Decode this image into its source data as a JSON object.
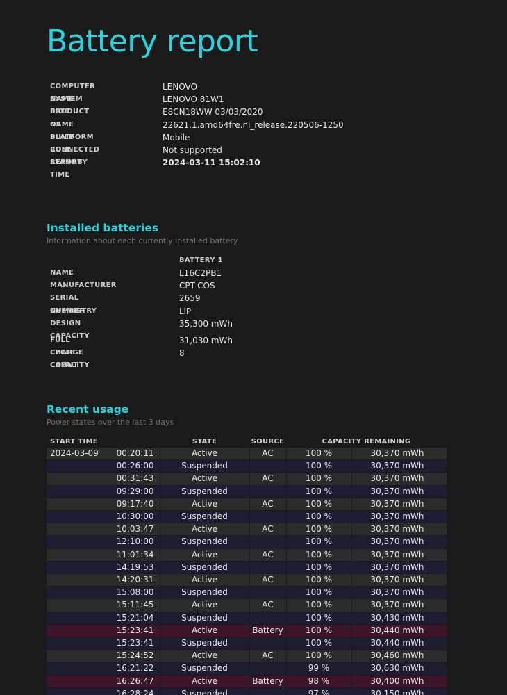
{
  "title": "Battery report",
  "system": [
    {
      "label": "COMPUTER NAME",
      "value": "LENOVO"
    },
    {
      "label": "SYSTEM PRODUCT NAME",
      "value": "LENOVO 81W1"
    },
    {
      "label": "BIOS",
      "value": "E8CN18WW 03/03/2020"
    },
    {
      "label": "OS BUILD",
      "value": "22621.1.amd64fre.ni_release.220506-1250"
    },
    {
      "label": "PLATFORM ROLE",
      "value": "Mobile"
    },
    {
      "label": "CONNECTED STANDBY",
      "value": "Not supported"
    },
    {
      "label": "REPORT TIME",
      "value": "2024-03-11  15:02:10"
    }
  ],
  "installed": {
    "heading": "Installed batteries",
    "subheading": "Information about each currently installed battery",
    "battery_header": "BATTERY 1",
    "rows": [
      {
        "label": "NAME",
        "value": "L16C2PB1"
      },
      {
        "label": "MANUFACTURER",
        "value": "CPT-COS"
      },
      {
        "label": "SERIAL NUMBER",
        "value": "2659"
      },
      {
        "label": "CHEMISTRY",
        "value": "LiP"
      },
      {
        "label": "DESIGN CAPACITY",
        "value": "35,300 mWh"
      },
      {
        "label": "FULL CHARGE CAPACITY",
        "value": "31,030 mWh"
      },
      {
        "label": "CYCLE COUNT",
        "value": "8"
      }
    ]
  },
  "recent": {
    "heading": "Recent usage",
    "subheading": "Power states over the last 3 days",
    "columns": {
      "start_time": "START TIME",
      "state": "STATE",
      "source": "SOURCE",
      "capacity": "CAPACITY REMAINING"
    },
    "rows": [
      {
        "date": "2024-03-09",
        "time": "00:20:11",
        "state": "Active",
        "source": "AC",
        "pct": "100 %",
        "cap": "30,370 mWh",
        "kind": "active"
      },
      {
        "date": "",
        "time": "00:26:00",
        "state": "Suspended",
        "source": "",
        "pct": "100 %",
        "cap": "30,370 mWh",
        "kind": "susp"
      },
      {
        "date": "",
        "time": "00:31:43",
        "state": "Active",
        "source": "AC",
        "pct": "100 %",
        "cap": "30,370 mWh",
        "kind": "active"
      },
      {
        "date": "",
        "time": "09:29:00",
        "state": "Suspended",
        "source": "",
        "pct": "100 %",
        "cap": "30,370 mWh",
        "kind": "susp"
      },
      {
        "date": "",
        "time": "09:17:40",
        "state": "Active",
        "source": "AC",
        "pct": "100 %",
        "cap": "30,370 mWh",
        "kind": "active"
      },
      {
        "date": "",
        "time": "10:30:00",
        "state": "Suspended",
        "source": "",
        "pct": "100 %",
        "cap": "30,370 mWh",
        "kind": "susp"
      },
      {
        "date": "",
        "time": "10:03:47",
        "state": "Active",
        "source": "AC",
        "pct": "100 %",
        "cap": "30,370 mWh",
        "kind": "active"
      },
      {
        "date": "",
        "time": "12:10:00",
        "state": "Suspended",
        "source": "",
        "pct": "100 %",
        "cap": "30,370 mWh",
        "kind": "susp"
      },
      {
        "date": "",
        "time": "11:01:34",
        "state": "Active",
        "source": "AC",
        "pct": "100 %",
        "cap": "30,370 mWh",
        "kind": "active"
      },
      {
        "date": "",
        "time": "14:19:53",
        "state": "Suspended",
        "source": "",
        "pct": "100 %",
        "cap": "30,370 mWh",
        "kind": "susp"
      },
      {
        "date": "",
        "time": "14:20:31",
        "state": "Active",
        "source": "AC",
        "pct": "100 %",
        "cap": "30,370 mWh",
        "kind": "active"
      },
      {
        "date": "",
        "time": "15:08:00",
        "state": "Suspended",
        "source": "",
        "pct": "100 %",
        "cap": "30,370 mWh",
        "kind": "susp"
      },
      {
        "date": "",
        "time": "15:11:45",
        "state": "Active",
        "source": "AC",
        "pct": "100 %",
        "cap": "30,370 mWh",
        "kind": "active"
      },
      {
        "date": "",
        "time": "15:21:04",
        "state": "Suspended",
        "source": "",
        "pct": "100 %",
        "cap": "30,430 mWh",
        "kind": "susp"
      },
      {
        "date": "",
        "time": "15:23:41",
        "state": "Active",
        "source": "Battery",
        "pct": "100 %",
        "cap": "30,440 mWh",
        "kind": "batt"
      },
      {
        "date": "",
        "time": "15:23:41",
        "state": "Suspended",
        "source": "",
        "pct": "100 %",
        "cap": "30,440 mWh",
        "kind": "susp"
      },
      {
        "date": "",
        "time": "15:24:52",
        "state": "Active",
        "source": "AC",
        "pct": "100 %",
        "cap": "30,460 mWh",
        "kind": "active"
      },
      {
        "date": "",
        "time": "16:21:22",
        "state": "Suspended",
        "source": "",
        "pct": "99 %",
        "cap": "30,630 mWh",
        "kind": "susp"
      },
      {
        "date": "",
        "time": "16:26:47",
        "state": "Active",
        "source": "Battery",
        "pct": "98 %",
        "cap": "30,400 mWh",
        "kind": "batt"
      },
      {
        "date": "",
        "time": "16:28:24",
        "state": "Suspended",
        "source": "",
        "pct": "97 %",
        "cap": "30,150 mWh",
        "kind": "susp"
      }
    ]
  },
  "colors": {
    "accent": "#2ad2de",
    "background": "#1a1a1a",
    "row_active": "#2b2b2b",
    "row_suspended": "#1c1c33",
    "row_battery": "#3d1428"
  }
}
